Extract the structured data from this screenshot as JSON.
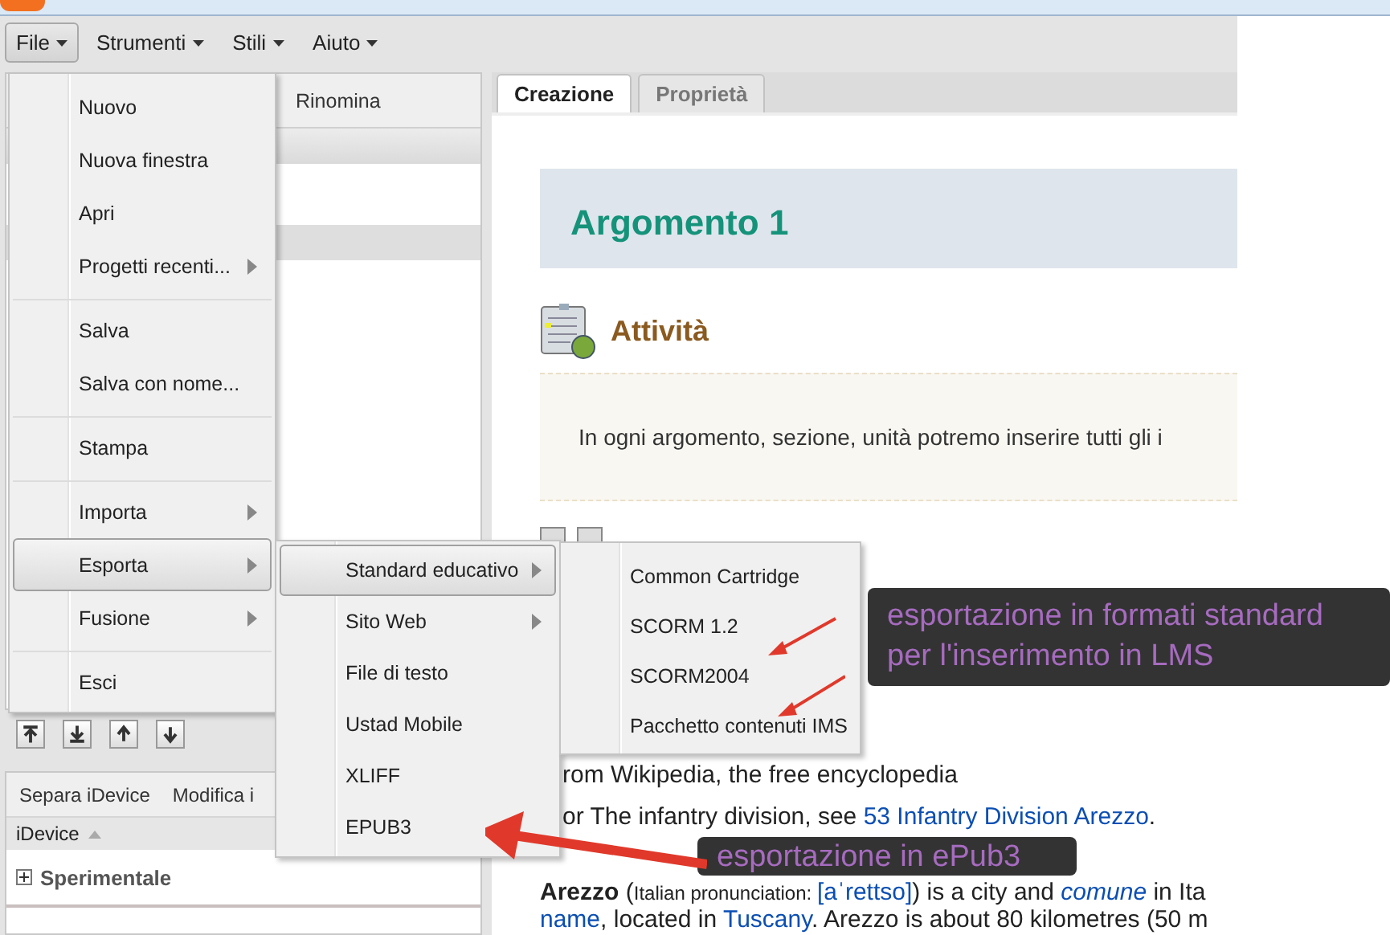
{
  "menubar": [
    {
      "label": "File",
      "selected": true
    },
    {
      "label": "Strumenti",
      "selected": false
    },
    {
      "label": "Stili",
      "selected": false
    },
    {
      "label": "Aiuto",
      "selected": false
    }
  ],
  "outline_panel": {
    "toolbar": [
      "Rinomina"
    ],
    "rows": [
      {
        "selected": true
      }
    ]
  },
  "idevice_panel": {
    "tabs": [
      "Separa iDevice",
      "Modifica i"
    ],
    "column": "iDevice",
    "groups": [
      {
        "label": "Sperimentale",
        "expanded": false
      }
    ]
  },
  "content_tabs": [
    {
      "label": "Creazione",
      "selected": true
    },
    {
      "label": "Proprietà",
      "selected": false
    }
  ],
  "page": {
    "title": "Argomento 1",
    "idevice_title": "Attività",
    "idevice_text": "In ogni argomento, sezione, unità potremo inserire tutti gli i",
    "lines": [
      [
        {
          "text": "rom Wikipedia, the free encyclopedia"
        }
      ],
      [
        {
          "text": "or The infantry division, see "
        },
        {
          "text": "53 Infantry Division Arezzo",
          "kind": "link"
        },
        {
          "text": "."
        }
      ],
      [
        {
          "text": "Arezzo",
          "kind": "bold"
        },
        {
          "text": " ("
        },
        {
          "text": "Italian pronunciation: ",
          "kind": "small"
        },
        {
          "text": "[aˈrettso]",
          "kind": "link"
        },
        {
          "text": ") is a city and "
        },
        {
          "text": "comune",
          "kind": "italic-link"
        },
        {
          "text": " in Ita"
        }
      ],
      [
        {
          "text": "name",
          "kind": "link"
        },
        {
          "text": ", located in "
        },
        {
          "text": "Tuscany",
          "kind": "link"
        },
        {
          "text": ". Arezzo is about 80 kilometres (50 m"
        }
      ]
    ]
  },
  "file_menu": [
    {
      "kind": "item",
      "label": "Nuovo",
      "submenu": false,
      "selected": false
    },
    {
      "kind": "item",
      "label": "Nuova finestra",
      "submenu": false,
      "selected": false
    },
    {
      "kind": "item",
      "label": "Apri",
      "submenu": false,
      "selected": false
    },
    {
      "kind": "item",
      "label": "Progetti recenti...",
      "submenu": true,
      "selected": false
    },
    {
      "kind": "separator"
    },
    {
      "kind": "item",
      "label": "Salva",
      "submenu": false,
      "selected": false
    },
    {
      "kind": "item",
      "label": "Salva con nome...",
      "submenu": false,
      "selected": false
    },
    {
      "kind": "separator"
    },
    {
      "kind": "item",
      "label": "Stampa",
      "submenu": false,
      "selected": false
    },
    {
      "kind": "separator"
    },
    {
      "kind": "item",
      "label": "Importa",
      "submenu": true,
      "selected": false
    },
    {
      "kind": "item",
      "label": "Esporta",
      "submenu": true,
      "selected": true
    },
    {
      "kind": "item",
      "label": "Fusione",
      "submenu": true,
      "selected": false
    },
    {
      "kind": "separator"
    },
    {
      "kind": "item",
      "label": "Esci",
      "submenu": false,
      "selected": false
    }
  ],
  "export_menu": [
    {
      "kind": "item",
      "label": "Standard educativo",
      "submenu": true,
      "selected": true
    },
    {
      "kind": "item",
      "label": "Sito Web",
      "submenu": true,
      "selected": false
    },
    {
      "kind": "item",
      "label": "File di testo",
      "submenu": false,
      "selected": false
    },
    {
      "kind": "item",
      "label": "Ustad Mobile",
      "submenu": false,
      "selected": false
    },
    {
      "kind": "item",
      "label": "XLIFF",
      "submenu": false,
      "selected": false
    },
    {
      "kind": "item",
      "label": "EPUB3",
      "submenu": false,
      "selected": false
    }
  ],
  "standard_menu": [
    {
      "kind": "item",
      "label": "Common Cartridge",
      "submenu": false,
      "selected": false
    },
    {
      "kind": "item",
      "label": "SCORM 1.2",
      "submenu": false,
      "selected": false
    },
    {
      "kind": "item",
      "label": "SCORM2004",
      "submenu": false,
      "selected": false
    },
    {
      "kind": "item",
      "label": "Pacchetto contenuti IMS",
      "submenu": false,
      "selected": false
    }
  ],
  "annotations": [
    {
      "text": "esportazione in formati standard\nper l'inserimento in LMS"
    },
    {
      "text": "esportazione in ePub3"
    }
  ]
}
